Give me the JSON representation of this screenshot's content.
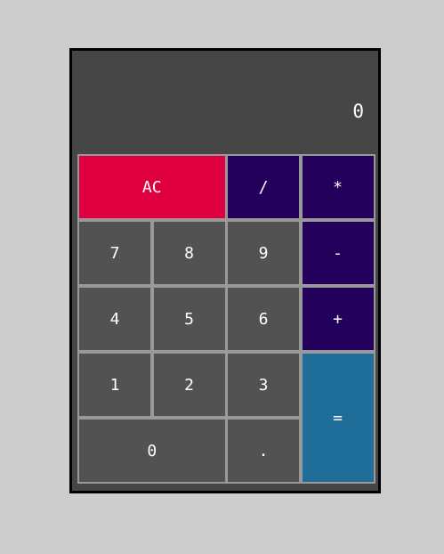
{
  "display": {
    "value": "0"
  },
  "keys": {
    "clear": "AC",
    "divide": "/",
    "multiply": "*",
    "seven": "7",
    "eight": "8",
    "nine": "9",
    "subtract": "-",
    "four": "4",
    "five": "5",
    "six": "6",
    "add": "+",
    "one": "1",
    "two": "2",
    "three": "3",
    "equals": "=",
    "zero": "0",
    "decimal": "."
  },
  "colors": {
    "page_background": "#cdcdcd",
    "body": "#464646",
    "key": "#525252",
    "clear_key": "#e0003f",
    "operator_key": "#24005d",
    "equals_key": "#1f6e99",
    "text": "#ffffff"
  }
}
